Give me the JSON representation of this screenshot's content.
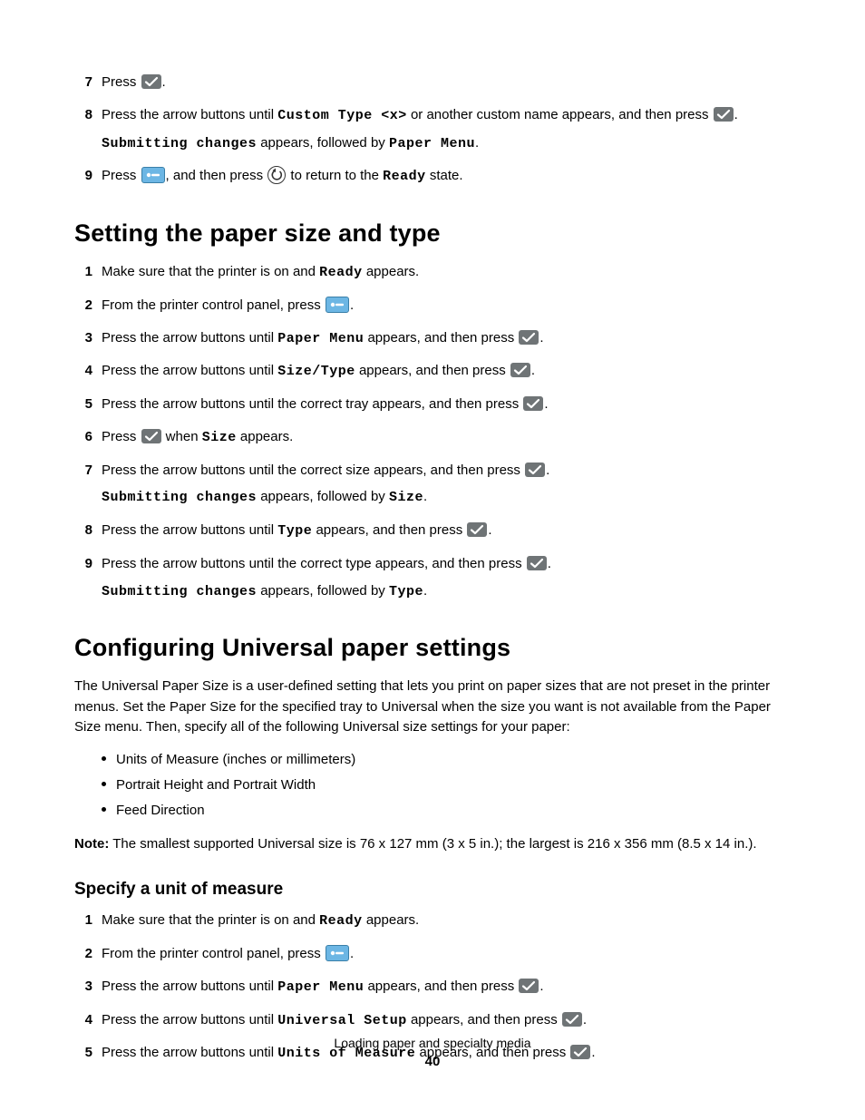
{
  "top_steps": [
    {
      "n": "7",
      "parts": [
        {
          "t": "Press "
        },
        {
          "icon": "check"
        },
        {
          "t": "."
        }
      ]
    },
    {
      "n": "8",
      "parts": [
        {
          "t": "Press the arrow buttons until "
        },
        {
          "m": "Custom Type <x>"
        },
        {
          "t": " or another custom name appears, and then press "
        },
        {
          "icon": "check"
        },
        {
          "t": "."
        }
      ],
      "sub": [
        {
          "m": "Submitting changes"
        },
        {
          "t": " appears, followed by "
        },
        {
          "m": "Paper Menu"
        },
        {
          "t": "."
        }
      ]
    },
    {
      "n": "9",
      "parts": [
        {
          "t": "Press "
        },
        {
          "icon": "menu"
        },
        {
          "t": ", and then press "
        },
        {
          "icon": "back"
        },
        {
          "t": " to return to the "
        },
        {
          "m": "Ready"
        },
        {
          "t": " state."
        }
      ]
    }
  ],
  "h1": "Setting the paper size and type",
  "size_steps": [
    {
      "n": "1",
      "parts": [
        {
          "t": "Make sure that the printer is on and "
        },
        {
          "m": "Ready"
        },
        {
          "t": " appears."
        }
      ]
    },
    {
      "n": "2",
      "parts": [
        {
          "t": "From the printer control panel, press "
        },
        {
          "icon": "menu"
        },
        {
          "t": "."
        }
      ]
    },
    {
      "n": "3",
      "parts": [
        {
          "t": "Press the arrow buttons until "
        },
        {
          "m": "Paper Menu"
        },
        {
          "t": " appears, and then press "
        },
        {
          "icon": "check"
        },
        {
          "t": "."
        }
      ]
    },
    {
      "n": "4",
      "parts": [
        {
          "t": "Press the arrow buttons until "
        },
        {
          "m": "Size/Type"
        },
        {
          "t": " appears, and then press "
        },
        {
          "icon": "check"
        },
        {
          "t": "."
        }
      ]
    },
    {
      "n": "5",
      "parts": [
        {
          "t": "Press the arrow buttons until the correct tray appears, and then press "
        },
        {
          "icon": "check"
        },
        {
          "t": "."
        }
      ]
    },
    {
      "n": "6",
      "parts": [
        {
          "t": "Press "
        },
        {
          "icon": "check"
        },
        {
          "t": " when "
        },
        {
          "m": "Size"
        },
        {
          "t": " appears."
        }
      ]
    },
    {
      "n": "7",
      "parts": [
        {
          "t": "Press the arrow buttons until the correct size appears, and then press "
        },
        {
          "icon": "check"
        },
        {
          "t": "."
        }
      ],
      "sub": [
        {
          "m": "Submitting changes"
        },
        {
          "t": " appears, followed by "
        },
        {
          "m": "Size"
        },
        {
          "t": "."
        }
      ]
    },
    {
      "n": "8",
      "parts": [
        {
          "t": "Press the arrow buttons until "
        },
        {
          "m": "Type"
        },
        {
          "t": " appears, and then press "
        },
        {
          "icon": "check"
        },
        {
          "t": "."
        }
      ]
    },
    {
      "n": "9",
      "parts": [
        {
          "t": "Press the arrow buttons until the correct type appears, and then press "
        },
        {
          "icon": "check"
        },
        {
          "t": "."
        }
      ],
      "sub": [
        {
          "m": "Submitting changes"
        },
        {
          "t": " appears, followed by "
        },
        {
          "m": "Type"
        },
        {
          "t": "."
        }
      ]
    }
  ],
  "h2": "Configuring Universal paper settings",
  "uni_intro": "The Universal Paper Size is a user-defined setting that lets you print on paper sizes that are not preset in the printer menus. Set the Paper Size for the specified tray to Universal when the size you want is not available from the Paper Size menu. Then, specify all of the following Universal size settings for your paper:",
  "uni_bullets": [
    "Units of Measure (inches or millimeters)",
    "Portrait Height and Portrait Width",
    "Feed Direction"
  ],
  "note_label": "Note:",
  "note_body": " The smallest supported Universal size is 76 x 127 mm (3  x 5 in.); the largest is 216 x 356 mm (8.5 x 14 in.).",
  "h3": "Specify a unit of measure",
  "measure_steps": [
    {
      "n": "1",
      "parts": [
        {
          "t": "Make sure that the printer is on and "
        },
        {
          "m": "Ready"
        },
        {
          "t": " appears."
        }
      ]
    },
    {
      "n": "2",
      "parts": [
        {
          "t": "From the printer control panel, press "
        },
        {
          "icon": "menu"
        },
        {
          "t": "."
        }
      ]
    },
    {
      "n": "3",
      "parts": [
        {
          "t": "Press the arrow buttons until "
        },
        {
          "m": "Paper Menu"
        },
        {
          "t": " appears, and then press "
        },
        {
          "icon": "check"
        },
        {
          "t": "."
        }
      ]
    },
    {
      "n": "4",
      "parts": [
        {
          "t": "Press the arrow buttons until "
        },
        {
          "m": "Universal Setup"
        },
        {
          "t": " appears, and then press "
        },
        {
          "icon": "check"
        },
        {
          "t": "."
        }
      ]
    },
    {
      "n": "5",
      "parts": [
        {
          "t": "Press the arrow buttons until "
        },
        {
          "m": "Units of Measure"
        },
        {
          "t": " appears, and then press "
        },
        {
          "icon": "check"
        },
        {
          "t": "."
        }
      ]
    }
  ],
  "footer_title": "Loading paper and specialty media",
  "footer_page": "40"
}
